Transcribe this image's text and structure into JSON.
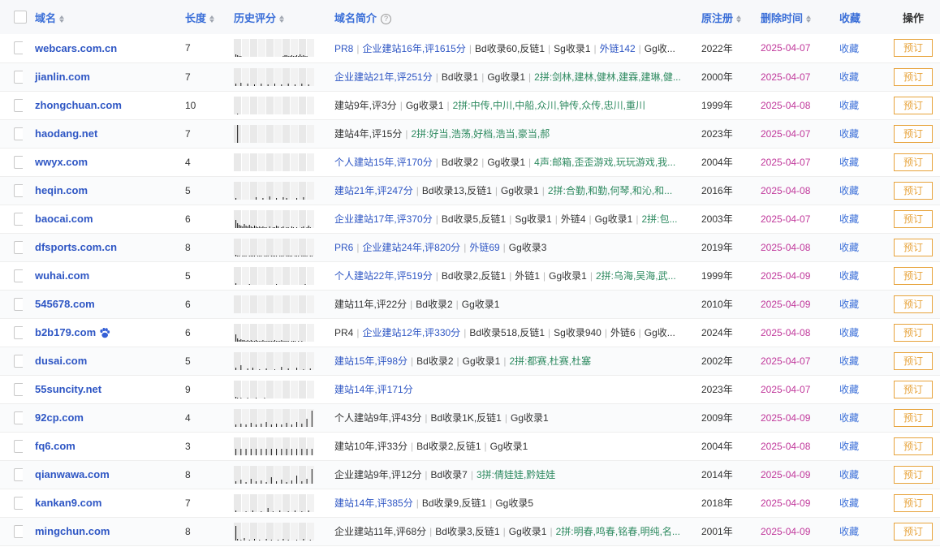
{
  "header": {
    "domain": "域名",
    "length": "长度",
    "history": "历史评分",
    "intro": "域名简介",
    "registered": "原注册",
    "deleted": "删除时间",
    "favorite": "收藏",
    "action": "操作"
  },
  "colors": {
    "domain": "#2e56c4",
    "deleted": "#c0389b",
    "reserve": "#e7a33b",
    "green_text": "#2e8a60"
  },
  "rows": [
    {
      "domain": "webcars.com.cn",
      "length": "7",
      "intro": [
        {
          "t": "PR8",
          "c": "blue"
        },
        {
          "t": "企业建站16年,评1615分",
          "c": "blue"
        },
        {
          "t": "Bd收录60,反链1",
          "c": "mixed"
        },
        {
          "t": "Sg收录1",
          "c": "dark"
        },
        {
          "t": "外链142",
          "c": "blue"
        },
        {
          "t": "Gg收...",
          "c": "dark"
        }
      ],
      "registered": "2022年",
      "deleted": "2025-04-07",
      "favorite": "收藏",
      "reserve": "预订",
      "badge": false,
      "hist": [
        0,
        3,
        2,
        1,
        1,
        0,
        0,
        0,
        0,
        0,
        0,
        0,
        0,
        0,
        0,
        0,
        0,
        0,
        0,
        0,
        0,
        0,
        0,
        0,
        0,
        0,
        0,
        0,
        0,
        1,
        2,
        2,
        1,
        1,
        2,
        1,
        1,
        2,
        1,
        3,
        1,
        2,
        1,
        1,
        0,
        0,
        0,
        0
      ]
    },
    {
      "domain": "jianlin.com",
      "length": "7",
      "intro": [
        {
          "t": "企业建站21年,评251分",
          "c": "blue"
        },
        {
          "t": "Bd收录1",
          "c": "dark"
        },
        {
          "t": "Gg收录1",
          "c": "dark"
        },
        {
          "t": "2拼:剑林,建林,健林,建霖,建琳,健...",
          "c": "green"
        }
      ],
      "registered": "2000年",
      "deleted": "2025-04-07",
      "favorite": "收藏",
      "reserve": "预订",
      "badge": false,
      "hist": [
        0,
        3,
        0,
        0,
        4,
        0,
        0,
        0,
        3,
        0,
        0,
        0,
        2,
        0,
        0,
        0,
        3,
        0,
        0,
        0,
        2,
        0,
        0,
        0,
        3,
        0,
        0,
        0,
        2,
        0,
        0,
        0,
        3,
        0,
        0,
        0,
        2,
        0,
        0,
        0,
        3,
        0,
        0,
        0,
        2,
        0,
        0,
        0
      ]
    },
    {
      "domain": "zhongchuan.com",
      "length": "10",
      "intro": [
        {
          "t": "建站9年,评3分",
          "c": "dark"
        },
        {
          "t": "Gg收录1",
          "c": "dark"
        },
        {
          "t": "2拼:中传,中川,中船,众川,钟传,众传,忠川,重川",
          "c": "green"
        }
      ],
      "registered": "1999年",
      "deleted": "2025-04-08",
      "favorite": "收藏",
      "reserve": "预订",
      "badge": false,
      "hist": [
        0,
        0,
        1,
        0,
        0,
        0,
        0,
        0,
        0,
        0,
        0,
        0,
        0,
        0,
        0,
        0,
        0,
        0,
        0,
        0,
        0,
        0,
        0,
        0,
        0,
        0,
        0,
        0,
        0,
        0,
        0,
        0,
        0,
        0,
        0,
        0,
        0,
        0,
        0,
        0,
        0,
        0,
        0,
        0,
        0,
        0,
        0,
        0
      ]
    },
    {
      "domain": "haodang.net",
      "length": "7",
      "intro": [
        {
          "t": "建站4年,评15分",
          "c": "dark"
        },
        {
          "t": "2拼:好当,浩荡,好档,浩当,豪当,郝",
          "c": "green"
        }
      ],
      "registered": "2023年",
      "deleted": "2025-04-07",
      "favorite": "收藏",
      "reserve": "预订",
      "badge": false,
      "hist": [
        0,
        0,
        22,
        0,
        0,
        0,
        0,
        0,
        0,
        0,
        0,
        0,
        0,
        0,
        0,
        0,
        0,
        0,
        0,
        0,
        0,
        0,
        0,
        0,
        0,
        0,
        0,
        0,
        0,
        0,
        0,
        0,
        0,
        0,
        0,
        0,
        0,
        0,
        0,
        0,
        0,
        0,
        0,
        0,
        0,
        0,
        0,
        0
      ]
    },
    {
      "domain": "wwyx.com",
      "length": "4",
      "intro": [
        {
          "t": "个人建站15年,评170分",
          "c": "blue"
        },
        {
          "t": "Bd收录2",
          "c": "dark"
        },
        {
          "t": "Gg收录1",
          "c": "dark"
        },
        {
          "t": "4声:邮箱,歪歪游戏,玩玩游戏,我...",
          "c": "green"
        }
      ],
      "registered": "2004年",
      "deleted": "2025-04-07",
      "favorite": "收藏",
      "reserve": "预订",
      "badge": false,
      "hist": [
        0,
        0,
        0,
        0,
        0,
        0,
        0,
        0,
        0,
        0,
        0,
        0,
        0,
        0,
        0,
        0,
        0,
        0,
        0,
        0,
        0,
        0,
        0,
        0,
        0,
        0,
        0,
        0,
        0,
        0,
        0,
        0,
        0,
        0,
        0,
        0,
        0,
        0,
        0,
        0,
        0,
        0,
        0,
        0,
        0,
        0,
        0,
        0
      ]
    },
    {
      "domain": "heqin.com",
      "length": "5",
      "intro": [
        {
          "t": "建站21年,评247分",
          "c": "blue"
        },
        {
          "t": "Bd收录13,反链1",
          "c": "dark"
        },
        {
          "t": "Gg收录1",
          "c": "dark"
        },
        {
          "t": "2拼:合勤,和勤,何琴,和沁,和...",
          "c": "green"
        }
      ],
      "registered": "2016年",
      "deleted": "2025-04-08",
      "favorite": "收藏",
      "reserve": "预订",
      "badge": false,
      "hist": [
        0,
        2,
        0,
        0,
        0,
        0,
        0,
        0,
        0,
        0,
        0,
        0,
        0,
        3,
        0,
        0,
        0,
        2,
        0,
        0,
        0,
        4,
        0,
        0,
        0,
        2,
        0,
        0,
        0,
        3,
        0,
        2,
        0,
        0,
        0,
        0,
        0,
        2,
        0,
        0,
        0,
        3,
        0,
        0,
        0,
        0,
        0,
        0
      ]
    },
    {
      "domain": "baocai.com",
      "length": "6",
      "intro": [
        {
          "t": "企业建站17年,评370分",
          "c": "blue"
        },
        {
          "t": "Bd收录5,反链1",
          "c": "dark"
        },
        {
          "t": "Sg收录1",
          "c": "dark"
        },
        {
          "t": "外链4",
          "c": "dark"
        },
        {
          "t": "Gg收录1",
          "c": "dark"
        },
        {
          "t": "2拼:包...",
          "c": "green"
        }
      ],
      "registered": "2003年",
      "deleted": "2025-04-07",
      "favorite": "收藏",
      "reserve": "预订",
      "badge": false,
      "hist": [
        0,
        10,
        6,
        4,
        3,
        2,
        5,
        3,
        2,
        4,
        2,
        1,
        3,
        2,
        1,
        2,
        1,
        2,
        1,
        1,
        0,
        2,
        0,
        1,
        1,
        3,
        2,
        0,
        1,
        2,
        0,
        1,
        1,
        0,
        2,
        1,
        0,
        1,
        0,
        0,
        1,
        2,
        0,
        1,
        3,
        1,
        0,
        0
      ]
    },
    {
      "domain": "dfsports.com.cn",
      "length": "8",
      "intro": [
        {
          "t": "PR6",
          "c": "blue"
        },
        {
          "t": "企业建站24年,评820分",
          "c": "blue"
        },
        {
          "t": "外链69",
          "c": "blue"
        },
        {
          "t": "Gg收录3",
          "c": "dark"
        }
      ],
      "registered": "2019年",
      "deleted": "2025-04-08",
      "favorite": "收藏",
      "reserve": "预订",
      "badge": false,
      "hist": [
        0,
        2,
        1,
        1,
        0,
        1,
        1,
        1,
        0,
        1,
        1,
        1,
        1,
        0,
        1,
        1,
        1,
        0,
        1,
        1,
        1,
        0,
        1,
        1,
        1,
        1,
        0,
        1,
        1,
        1,
        0,
        1,
        1,
        1,
        1,
        0,
        1,
        1,
        1,
        0,
        1,
        1,
        1,
        1,
        0,
        1,
        1,
        0
      ]
    },
    {
      "domain": "wuhai.com",
      "length": "5",
      "intro": [
        {
          "t": "个人建站22年,评519分",
          "c": "blue"
        },
        {
          "t": "Bd收录2,反链1",
          "c": "dark"
        },
        {
          "t": "外链1",
          "c": "dark"
        },
        {
          "t": "Gg收录1",
          "c": "dark"
        },
        {
          "t": "2拼:乌海,吴海,武...",
          "c": "green"
        }
      ],
      "registered": "1999年",
      "deleted": "2025-04-09",
      "favorite": "收藏",
      "reserve": "预订",
      "badge": false,
      "hist": [
        0,
        2,
        0,
        0,
        0,
        0,
        0,
        0,
        0,
        1,
        0,
        0,
        0,
        0,
        0,
        0,
        0,
        0,
        0,
        0,
        0,
        0,
        0,
        0,
        0,
        1,
        0,
        0,
        0,
        0,
        0,
        0,
        0,
        0,
        0,
        0,
        0,
        0,
        0,
        0,
        0,
        0,
        1,
        0,
        0,
        0,
        0,
        0
      ]
    },
    {
      "domain": "545678.com",
      "length": "6",
      "intro": [
        {
          "t": "建站11年,评22分",
          "c": "dark"
        },
        {
          "t": "Bd收录2",
          "c": "dark"
        },
        {
          "t": "Gg收录1",
          "c": "dark"
        }
      ],
      "registered": "2010年",
      "deleted": "2025-04-09",
      "favorite": "收藏",
      "reserve": "预订",
      "badge": false,
      "hist": [
        0,
        0,
        0,
        0,
        0,
        0,
        0,
        0,
        0,
        0,
        0,
        0,
        0,
        0,
        0,
        0,
        0,
        0,
        0,
        0,
        0,
        0,
        0,
        0,
        0,
        0,
        0,
        0,
        0,
        0,
        0,
        0,
        0,
        0,
        0,
        0,
        0,
        0,
        0,
        0,
        0,
        0,
        0,
        0,
        0,
        0,
        0,
        0
      ]
    },
    {
      "domain": "b2b179.com",
      "length": "6",
      "intro": [
        {
          "t": "PR4",
          "c": "dark"
        },
        {
          "t": "企业建站12年,评330分",
          "c": "blue"
        },
        {
          "t": "Bd收录518,反链1",
          "c": "mixed"
        },
        {
          "t": "Sg收录940",
          "c": "mixed"
        },
        {
          "t": "外链6",
          "c": "dark"
        },
        {
          "t": "Gg收...",
          "c": "dark"
        }
      ],
      "registered": "2024年",
      "deleted": "2025-04-08",
      "favorite": "收藏",
      "reserve": "预订",
      "badge": true,
      "hist": [
        0,
        9,
        4,
        2,
        3,
        2,
        2,
        1,
        2,
        1,
        2,
        1,
        1,
        2,
        1,
        1,
        1,
        2,
        1,
        1,
        1,
        1,
        1,
        1,
        2,
        1,
        1,
        1,
        2,
        1,
        1,
        1,
        1,
        0,
        1,
        1,
        1,
        0,
        1,
        0,
        1,
        0,
        0,
        0,
        0,
        0,
        0,
        0
      ]
    },
    {
      "domain": "dusai.com",
      "length": "5",
      "intro": [
        {
          "t": "建站15年,评98分",
          "c": "blue"
        },
        {
          "t": "Bd收录2",
          "c": "dark"
        },
        {
          "t": "Gg收录1",
          "c": "dark"
        },
        {
          "t": "2拼:都赛,杜赛,杜塞",
          "c": "green"
        }
      ],
      "registered": "2002年",
      "deleted": "2025-04-07",
      "favorite": "收藏",
      "reserve": "预订",
      "badge": false,
      "hist": [
        0,
        3,
        0,
        0,
        6,
        0,
        0,
        0,
        2,
        0,
        0,
        3,
        0,
        0,
        0,
        1,
        0,
        0,
        0,
        2,
        0,
        0,
        0,
        0,
        1,
        0,
        0,
        0,
        4,
        0,
        0,
        0,
        2,
        0,
        0,
        0,
        0,
        3,
        0,
        0,
        0,
        1,
        0,
        0,
        0,
        2,
        0,
        0
      ]
    },
    {
      "domain": "55suncity.net",
      "length": "9",
      "intro": [
        {
          "t": "建站14年,评171分",
          "c": "blue"
        }
      ],
      "registered": "2023年",
      "deleted": "2025-04-07",
      "favorite": "收藏",
      "reserve": "预订",
      "badge": false,
      "hist": [
        0,
        2,
        1,
        0,
        1,
        0,
        0,
        0,
        1,
        0,
        0,
        0,
        0,
        1,
        0,
        0,
        0,
        0,
        1,
        0,
        0,
        0,
        0,
        0,
        0,
        0,
        0,
        0,
        0,
        0,
        0,
        0,
        0,
        0,
        0,
        0,
        0,
        0,
        0,
        0,
        0,
        0,
        0,
        0,
        0,
        0,
        0,
        0
      ]
    },
    {
      "domain": "92cp.com",
      "length": "4",
      "intro": [
        {
          "t": "个人建站9年,评43分",
          "c": "dark"
        },
        {
          "t": "Bd收录1K,反链1",
          "c": "mixed"
        },
        {
          "t": "Gg收录1",
          "c": "dark"
        }
      ],
      "registered": "2009年",
      "deleted": "2025-04-09",
      "favorite": "收藏",
      "reserve": "预订",
      "badge": false,
      "hist": [
        0,
        3,
        0,
        0,
        4,
        0,
        0,
        3,
        0,
        0,
        5,
        0,
        0,
        3,
        0,
        0,
        4,
        0,
        0,
        6,
        0,
        0,
        3,
        0,
        0,
        4,
        0,
        0,
        3,
        0,
        0,
        5,
        0,
        0,
        3,
        0,
        0,
        6,
        0,
        0,
        4,
        0,
        0,
        10,
        0,
        0,
        20,
        0
      ]
    },
    {
      "domain": "fq6.com",
      "length": "3",
      "intro": [
        {
          "t": "建站10年,评33分",
          "c": "dark"
        },
        {
          "t": "Bd收录2,反链1",
          "c": "dark"
        },
        {
          "t": "Gg收录1",
          "c": "dark"
        }
      ],
      "registered": "2004年",
      "deleted": "2025-04-08",
      "favorite": "收藏",
      "reserve": "预订",
      "badge": false,
      "hist": [
        0,
        8,
        0,
        0,
        8,
        0,
        0,
        8,
        0,
        0,
        8,
        0,
        0,
        8,
        0,
        0,
        8,
        0,
        0,
        8,
        0,
        0,
        8,
        0,
        0,
        8,
        0,
        0,
        8,
        0,
        0,
        8,
        0,
        0,
        8,
        0,
        0,
        8,
        0,
        0,
        8,
        0,
        0,
        8,
        0,
        0,
        8,
        0
      ]
    },
    {
      "domain": "qianwawa.com",
      "length": "8",
      "intro": [
        {
          "t": "企业建站9年,评12分",
          "c": "dark"
        },
        {
          "t": "Bd收录7",
          "c": "dark"
        },
        {
          "t": "3拼:倩娃娃,黔娃娃",
          "c": "green"
        }
      ],
      "registered": "2014年",
      "deleted": "2025-04-09",
      "favorite": "收藏",
      "reserve": "预订",
      "badge": false,
      "hist": [
        0,
        3,
        0,
        0,
        5,
        0,
        0,
        2,
        0,
        0,
        6,
        0,
        0,
        3,
        0,
        0,
        4,
        0,
        0,
        2,
        0,
        0,
        8,
        0,
        0,
        3,
        0,
        0,
        5,
        0,
        0,
        2,
        0,
        0,
        4,
        0,
        0,
        10,
        0,
        0,
        3,
        0,
        0,
        6,
        0,
        0,
        18,
        0
      ]
    },
    {
      "domain": "kankan9.com",
      "length": "7",
      "intro": [
        {
          "t": "建站14年,评385分",
          "c": "blue"
        },
        {
          "t": "Bd收录9,反链1",
          "c": "dark"
        },
        {
          "t": "Gg收录5",
          "c": "dark"
        }
      ],
      "registered": "2018年",
      "deleted": "2025-04-09",
      "favorite": "收藏",
      "reserve": "预订",
      "badge": false,
      "hist": [
        0,
        2,
        0,
        0,
        0,
        0,
        0,
        1,
        0,
        0,
        0,
        2,
        0,
        0,
        0,
        0,
        1,
        0,
        0,
        0,
        5,
        0,
        0,
        1,
        0,
        0,
        0,
        2,
        0,
        0,
        0,
        0,
        1,
        0,
        0,
        0,
        2,
        0,
        0,
        0,
        1,
        0,
        0,
        0,
        2,
        0,
        0,
        0
      ]
    },
    {
      "domain": "mingchun.com",
      "length": "8",
      "intro": [
        {
          "t": "企业建站11年,评68分",
          "c": "dark"
        },
        {
          "t": "Bd收录3,反链1",
          "c": "dark"
        },
        {
          "t": "Gg收录1",
          "c": "dark"
        },
        {
          "t": "2拼:明春,鸣春,铭春,明纯,名...",
          "c": "green"
        }
      ],
      "registered": "2001年",
      "deleted": "2025-04-09",
      "favorite": "收藏",
      "reserve": "预订",
      "badge": false,
      "hist": [
        0,
        18,
        2,
        0,
        1,
        0,
        3,
        0,
        0,
        1,
        0,
        0,
        2,
        0,
        0,
        1,
        0,
        0,
        0,
        2,
        0,
        0,
        1,
        0,
        0,
        0,
        1,
        0,
        0,
        2,
        0,
        0,
        1,
        0,
        0,
        0,
        0,
        1,
        0,
        0,
        0,
        2,
        0,
        0,
        0,
        1,
        0,
        0
      ]
    }
  ]
}
